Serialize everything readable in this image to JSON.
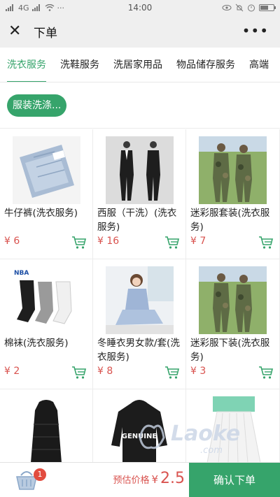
{
  "statusbar": {
    "carrier": "4G",
    "time": "14:00"
  },
  "header": {
    "title": "下单"
  },
  "tabs": [
    {
      "label": "洗衣服务",
      "active": true
    },
    {
      "label": "洗鞋服务",
      "active": false
    },
    {
      "label": "洗居家用品",
      "active": false
    },
    {
      "label": "物品储存服务",
      "active": false
    },
    {
      "label": "高端",
      "active": false
    }
  ],
  "filter_chip": {
    "label": "服装洗涤..."
  },
  "products": [
    {
      "name": "牛仔裤(洗衣服务)",
      "currency": "¥",
      "price": "6",
      "image": "jeans"
    },
    {
      "name": "西服（干洗）(洗衣服务)",
      "currency": "¥",
      "price": "16",
      "image": "suit"
    },
    {
      "name": "迷彩服套装(洗衣服务)",
      "currency": "¥",
      "price": "7",
      "image": "camo"
    },
    {
      "name": "棉袜(洗衣服务)",
      "currency": "¥",
      "price": "2",
      "image": "socks"
    },
    {
      "name": "冬睡衣男女款/套(洗衣服务)",
      "currency": "¥",
      "price": "8",
      "image": "pajamas"
    },
    {
      "name": "迷彩服下装(洗衣服务)",
      "currency": "¥",
      "price": "3",
      "image": "camo"
    },
    {
      "name": "",
      "currency": "",
      "price": "",
      "image": "downcoat"
    },
    {
      "name": "",
      "currency": "",
      "price": "",
      "image": "hoodie"
    },
    {
      "name": "",
      "currency": "",
      "price": "",
      "image": "skirt"
    }
  ],
  "image_text": {
    "socks_brand": "NBA",
    "hoodie_brand": "GENUINE"
  },
  "cart": {
    "count": "1"
  },
  "footer": {
    "estimate_label": "预估价格",
    "currency": "¥",
    "estimate_value": "2.5",
    "confirm_label": "确认下单"
  },
  "watermark": {
    "text": "Laoke",
    "subtext": ".com"
  },
  "colors": {
    "accent": "#36a46b",
    "price": "#d9534f",
    "badge": "#e24c3f"
  }
}
